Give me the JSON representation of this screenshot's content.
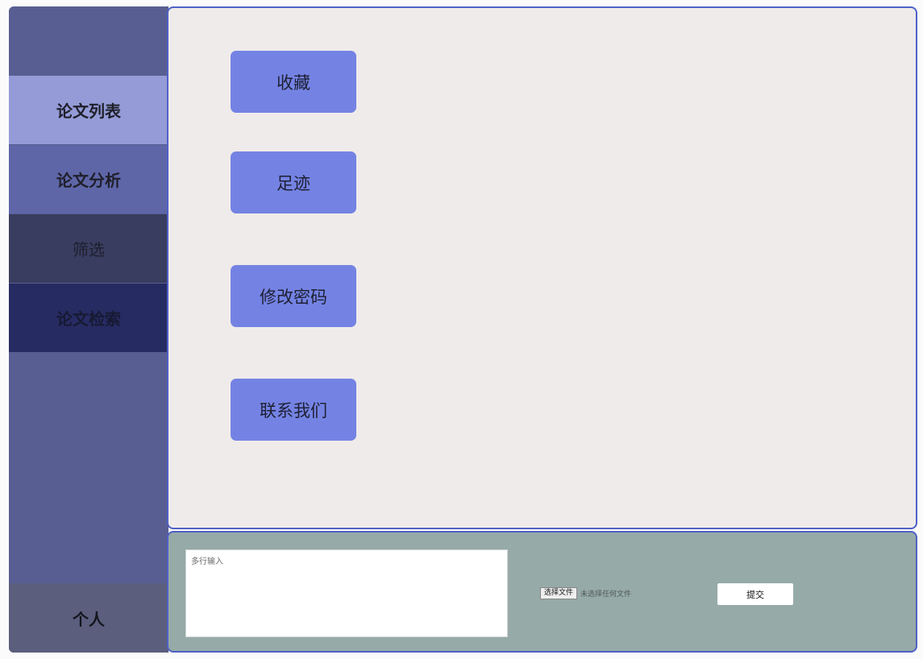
{
  "sidebar": {
    "items": [
      {
        "label": "论文列表"
      },
      {
        "label": "论文分析"
      },
      {
        "label": "筛选"
      },
      {
        "label": "论文检索"
      }
    ],
    "personal_label": "个人"
  },
  "main": {
    "buttons": [
      {
        "label": "收藏"
      },
      {
        "label": "足迹"
      },
      {
        "label": "修改密码"
      },
      {
        "label": "联系我们"
      }
    ]
  },
  "bottom": {
    "textarea_placeholder": "多行输入",
    "file_button_label": "选择文件",
    "file_status": "未选择任何文件",
    "submit_label": "提交"
  },
  "colors": {
    "sidebar_bg": "#595e92",
    "active_item": "#949bd6",
    "panel_border": "#4f61c6",
    "menu_button": "#7483e3",
    "bottom_bg": "#96aaa8"
  }
}
